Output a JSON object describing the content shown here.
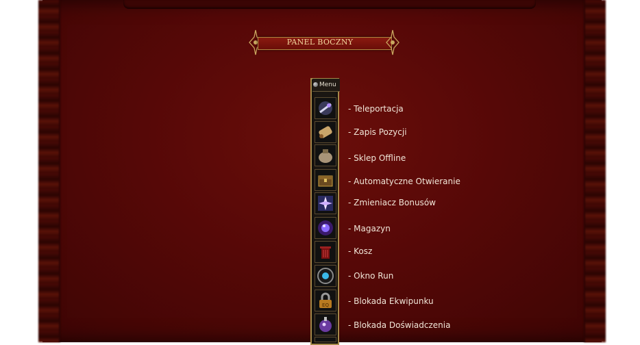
{
  "panel": {
    "title": "PANEL BOCZNY"
  },
  "sidebar": {
    "menu_label": "Menu",
    "items": [
      {
        "label": "- Teleportacja",
        "icon": "teleport-icon"
      },
      {
        "label": "- Zapis Pozycji",
        "icon": "scroll-icon"
      },
      {
        "label": "- Sklep Offline",
        "icon": "bag-icon"
      },
      {
        "label": "- Automatyczne Otwieranie",
        "icon": "chest-icon"
      },
      {
        "label": "- Zmieniacz Bonusów",
        "icon": "star-icon"
      },
      {
        "label": "- Magazyn",
        "icon": "orb-icon"
      },
      {
        "label": "- Kosz",
        "icon": "trash-icon"
      },
      {
        "label": "- Okno Run",
        "icon": "rune-icon"
      },
      {
        "label": "- Blokada Ekwipunku",
        "icon": "lock-icon"
      },
      {
        "label": "- Blokada Doświadczenia",
        "icon": "potion-icon"
      }
    ]
  },
  "colors": {
    "background": "#560807",
    "text": "#f1e6d8",
    "gold": "#a58a4a"
  }
}
